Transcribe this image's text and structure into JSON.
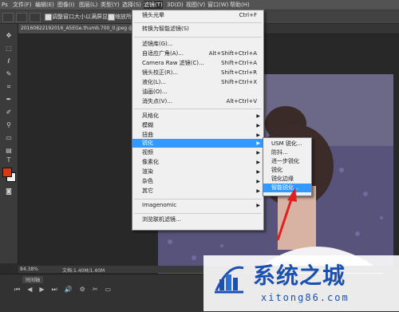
{
  "menubar": {
    "items": [
      "文件(F)",
      "编辑(E)",
      "图像(I)",
      "图层(L)",
      "类型(Y)",
      "选择(S)",
      "滤镜(T)",
      "3D(D)",
      "视图(V)",
      "窗口(W)",
      "帮助(H)"
    ],
    "active": "滤镜(T)"
  },
  "optionsbar": {
    "resize_label": "调整窗口大小以满屏显示",
    "zoom_all_label": "缩放所有"
  },
  "document_tab": {
    "title": "20160822192016_A5EGe.thumb.700_0.jpeg @ 84.4"
  },
  "status": {
    "zoom": "84.38%",
    "doc": "文档:1.40M/1.40M"
  },
  "timeline": {
    "label": "时间轴"
  },
  "filter_menu": {
    "last_filter": {
      "label": "镜头光晕",
      "shortcut": "Ctrl+F"
    },
    "convert_smart": {
      "label": "转换为智能滤镜(S)"
    },
    "gallery": {
      "label": "滤镜库(G)..."
    },
    "adaptive_wide": {
      "label": "自适应广角(A)...",
      "shortcut": "Alt+Shift+Ctrl+A"
    },
    "camera_raw": {
      "label": "Camera Raw 滤镜(C)...",
      "shortcut": "Shift+Ctrl+A"
    },
    "lens_correction": {
      "label": "镜头校正(R)...",
      "shortcut": "Shift+Ctrl+R"
    },
    "liquify": {
      "label": "液化(L)...",
      "shortcut": "Shift+Ctrl+X"
    },
    "oil_paint": {
      "label": "油画(O)..."
    },
    "vanishing_point": {
      "label": "消失点(V)...",
      "shortcut": "Alt+Ctrl+V"
    },
    "stylize": {
      "label": "风格化"
    },
    "blur": {
      "label": "模糊"
    },
    "distort": {
      "label": "扭曲"
    },
    "sharpen": {
      "label": "锐化"
    },
    "video": {
      "label": "视频"
    },
    "pixelate": {
      "label": "像素化"
    },
    "render": {
      "label": "渲染"
    },
    "noise": {
      "label": "杂色"
    },
    "other": {
      "label": "其它"
    },
    "imagenomic": {
      "label": "Imagenomic"
    },
    "browse_online": {
      "label": "浏览联机滤镜..."
    }
  },
  "sharpen_submenu": {
    "usm": "USM 锐化...",
    "shake_reduction": "防抖...",
    "sharpen_more": "进一步锐化",
    "sharpen": "锐化",
    "sharpen_edges": "锐化边缘",
    "smart_sharpen": "智能锐化..."
  },
  "watermark": {
    "title": "系统之城",
    "url": "xitong86.com"
  },
  "colors": {
    "highlight": "#3399ff",
    "foreground_swatch": "#d63a14",
    "watermark_blue": "#1b4fb0",
    "annotation_red": "#e02020"
  }
}
